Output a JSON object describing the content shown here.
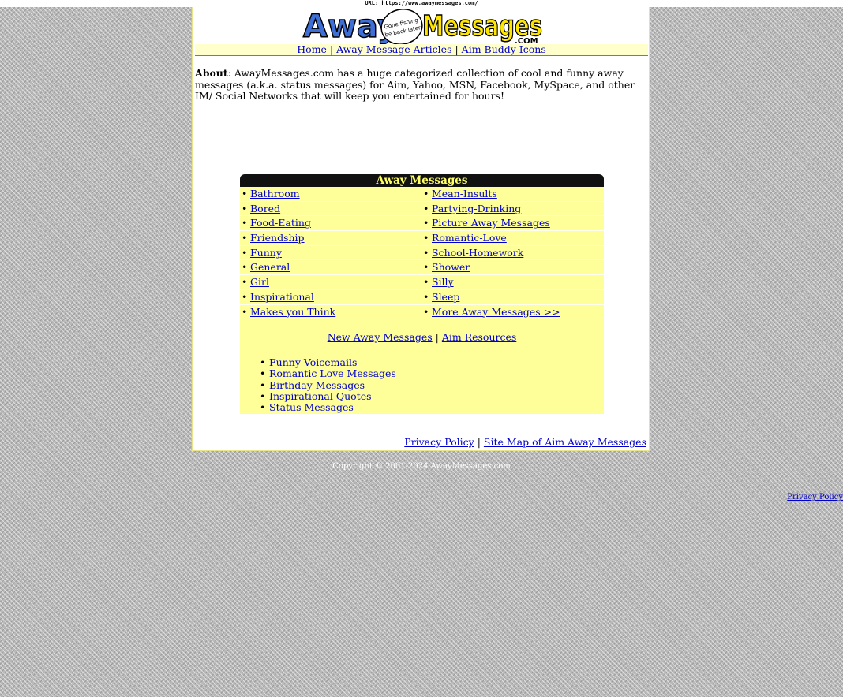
{
  "url_banner": "URL: https://www.awaymessages.com/",
  "logo": {
    "word1": "Away",
    "word2": "Messages",
    "domain": ".COM",
    "badge_line1": "Gone fishing",
    "badge_line2": "be back later"
  },
  "nav": {
    "home": "Home",
    "sep1": "|",
    "articles": "Away Message Articles",
    "sep2": "|",
    "icons": "Aim Buddy Icons"
  },
  "about": {
    "label": "About",
    "text": ": AwayMessages.com has a huge categorized collection of cool and funny away messages (a.k.a. status messages) for Aim, Yahoo, MSN, Facebook, MySpace, and other IM/ Social Networks that will keep you entertained for hours!"
  },
  "categories": {
    "heading": "Away Messages",
    "bullet": "•",
    "left": [
      "Bathroom",
      "Bored",
      "Food-Eating",
      "Friendship",
      "Funny",
      "General",
      "Girl",
      "Inspirational",
      "Makes you Think"
    ],
    "right": [
      "Mean-Insults",
      "Partying-Drinking",
      "Picture Away Messages",
      "Romantic-Love",
      "School-Homework",
      "Shower",
      "Silly",
      "Sleep",
      "More Away Messages >>"
    ]
  },
  "resources": {
    "new_messages": "New Away Messages",
    "sep": "|",
    "aim_resources": "Aim Resources"
  },
  "extra_links": [
    "Funny Voicemails",
    "Romantic Love Messages",
    "Birthday Messages",
    "Inspirational Quotes",
    "Status Messages"
  ],
  "footer": {
    "privacy": "Privacy Policy",
    "sep": "|",
    "sitemap": "Site Map of Aim Away Messages",
    "copyright": "Copyright © 2001-2024 AwayMessages.com",
    "privacy_outer": "Privacy Policy"
  },
  "colors": {
    "accent_yellow": "#ffff99",
    "link": "#0000cc",
    "header_text": "#ffff66"
  }
}
